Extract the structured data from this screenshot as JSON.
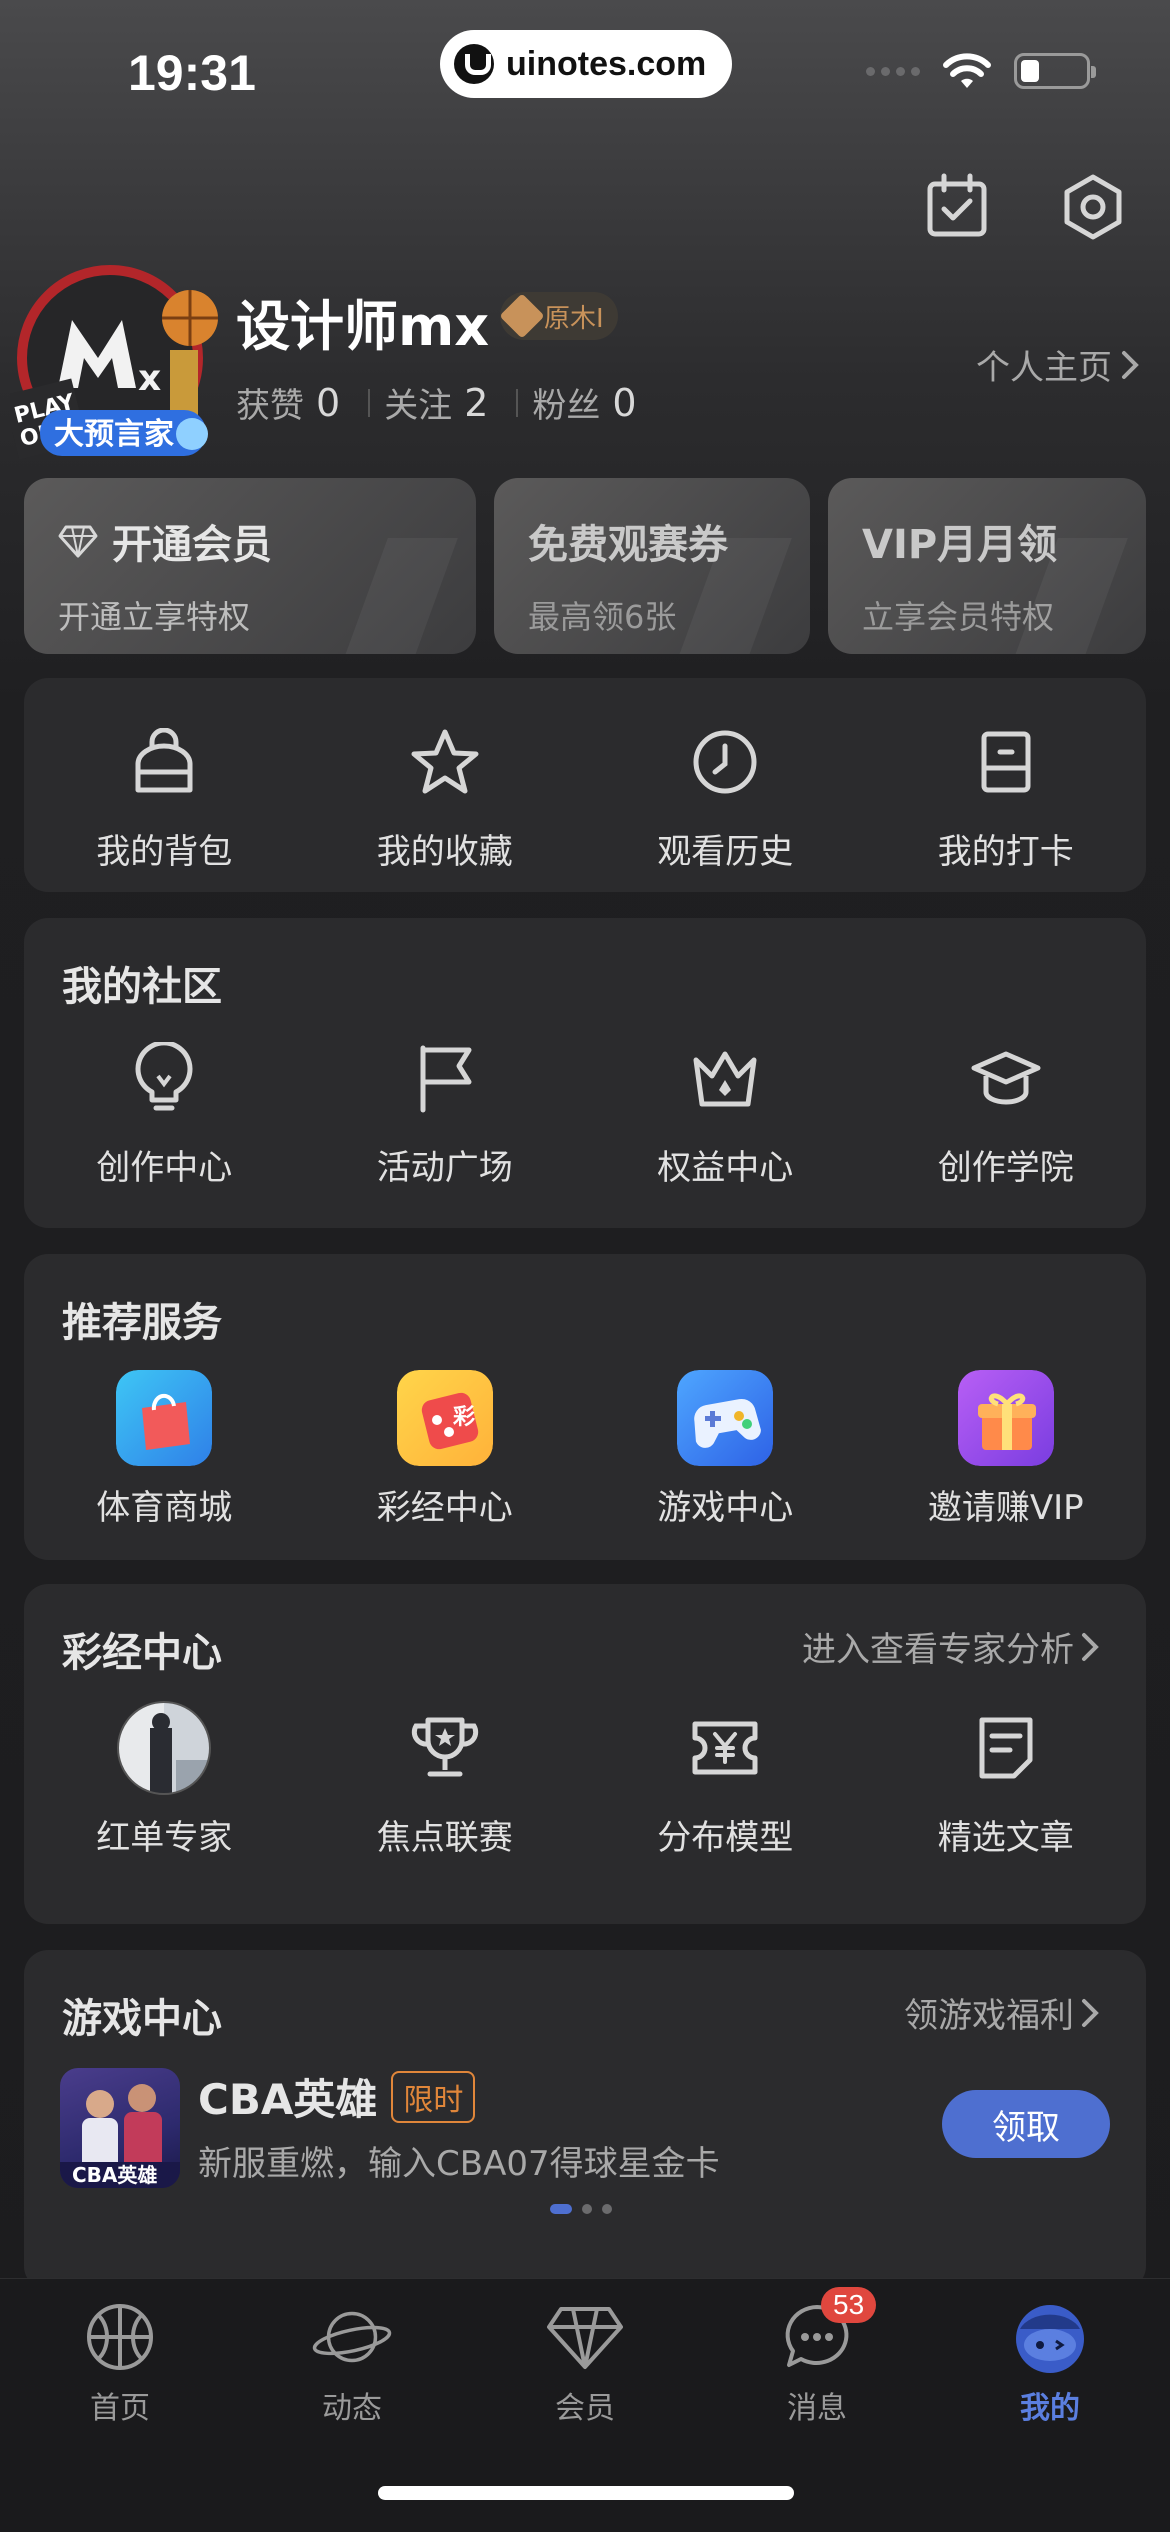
{
  "status_bar": {
    "time": "19:31",
    "url": "uinotes.com"
  },
  "profile": {
    "username": "设计师mx",
    "level_badge": "原木I",
    "stats": [
      {
        "label": "获赞",
        "value": "0"
      },
      {
        "label": "关注",
        "value": "2"
      },
      {
        "label": "粉丝",
        "value": "0"
      }
    ],
    "home_link": "个人主页"
  },
  "vip_cards": [
    {
      "title": "开通会员",
      "subtitle": "开通立享特权"
    },
    {
      "title": "免费观赛券",
      "subtitle": "最高领6张"
    },
    {
      "title": "VIP月月领",
      "subtitle": "立享会员特权"
    }
  ],
  "quick_actions": [
    {
      "label": "我的背包",
      "icon": "backpack-icon"
    },
    {
      "label": "我的收藏",
      "icon": "star-icon"
    },
    {
      "label": "观看历史",
      "icon": "clock-icon"
    },
    {
      "label": "我的打卡",
      "icon": "checkin-icon"
    }
  ],
  "community": {
    "title": "我的社区",
    "items": [
      {
        "label": "创作中心",
        "icon": "bulb-icon"
      },
      {
        "label": "活动广场",
        "icon": "flag-icon"
      },
      {
        "label": "权益中心",
        "icon": "crown-icon"
      },
      {
        "label": "创作学院",
        "icon": "graduation-cap-icon"
      }
    ]
  },
  "services": {
    "title": "推荐服务",
    "items": [
      {
        "label": "体育商城",
        "icon": "shopping-bag-icon"
      },
      {
        "label": "彩经中心",
        "icon": "lottery-icon"
      },
      {
        "label": "游戏中心",
        "icon": "gamepad-icon"
      },
      {
        "label": "邀请赚VIP",
        "icon": "gift-icon"
      }
    ]
  },
  "lottery": {
    "title": "彩经中心",
    "link": "进入查看专家分析",
    "items": [
      {
        "label": "红单专家",
        "icon": "expert-avatar"
      },
      {
        "label": "焦点联赛",
        "icon": "trophy-icon"
      },
      {
        "label": "分布模型",
        "icon": "ticket-yen-icon"
      },
      {
        "label": "精选文章",
        "icon": "article-icon"
      }
    ]
  },
  "game_center": {
    "title": "游戏中心",
    "link": "领游戏福利",
    "game": {
      "name": "CBA英雄",
      "tag": "限时",
      "desc": "新服重燃，输入CBA07得球星金卡",
      "thumb_text": "CBA英雄",
      "button": "领取"
    }
  },
  "tabbar": {
    "items": [
      {
        "label": "首页",
        "icon": "basketball-icon"
      },
      {
        "label": "动态",
        "icon": "planet-icon"
      },
      {
        "label": "会员",
        "icon": "diamond-icon"
      },
      {
        "label": "消息",
        "icon": "chat-icon",
        "badge": "53"
      },
      {
        "label": "我的",
        "icon": "mascot-icon",
        "active": true
      }
    ]
  },
  "colors": {
    "accent": "#4e6fd0",
    "badge": "#e0473e",
    "limited_tag": "#e0863a"
  }
}
